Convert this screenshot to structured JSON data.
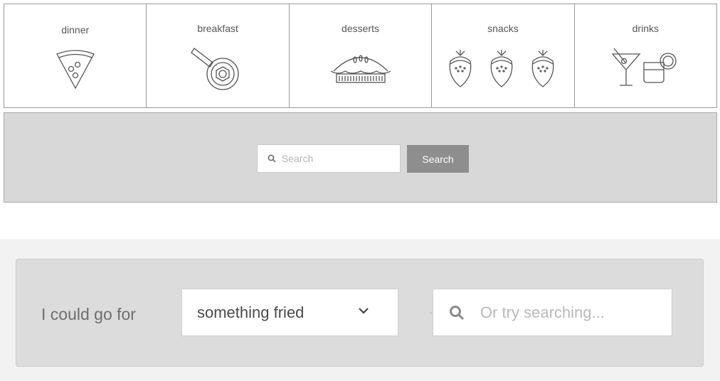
{
  "categories": [
    {
      "label": "dinner",
      "icon": "pizza-slice-icon"
    },
    {
      "label": "breakfast",
      "icon": "frying-pan-egg-icon"
    },
    {
      "label": "desserts",
      "icon": "pie-icon"
    },
    {
      "label": "snacks",
      "icon": "strawberries-icon"
    },
    {
      "label": "drinks",
      "icon": "cocktail-glasses-icon"
    }
  ],
  "search": {
    "placeholder": "Search",
    "button_label": "Search"
  },
  "craving": {
    "label": "I could go for",
    "selected_option": "something fried",
    "search_placeholder": "Or try searching..."
  },
  "colors": {
    "panel_gray": "#d8d8d8",
    "button_gray": "#8e8e8e",
    "icon_stroke": "#555555"
  }
}
